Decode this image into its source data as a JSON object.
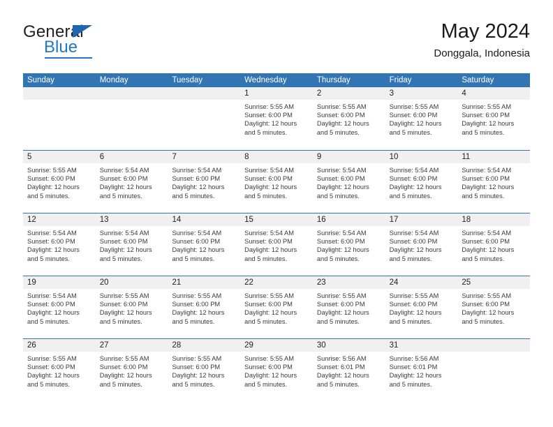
{
  "logo": {
    "word_one": "General",
    "word_two": "Blue",
    "triangle_color": "#1f66ad",
    "blue_color": "#2079c6"
  },
  "header": {
    "title": "May 2024",
    "subtitle": "Donggala, Indonesia"
  },
  "theme": {
    "header_blue": "#3175b5",
    "day_band_gray": "#f0f0f0",
    "text_color": "#3a3a3a"
  },
  "weekdays": [
    "Sunday",
    "Monday",
    "Tuesday",
    "Wednesday",
    "Thursday",
    "Friday",
    "Saturday"
  ],
  "weeks": [
    [
      {
        "day": "",
        "lines": []
      },
      {
        "day": "",
        "lines": []
      },
      {
        "day": "",
        "lines": []
      },
      {
        "day": "1",
        "lines": [
          "Sunrise: 5:55 AM",
          "Sunset: 6:00 PM",
          "Daylight: 12 hours",
          "and 5 minutes."
        ]
      },
      {
        "day": "2",
        "lines": [
          "Sunrise: 5:55 AM",
          "Sunset: 6:00 PM",
          "Daylight: 12 hours",
          "and 5 minutes."
        ]
      },
      {
        "day": "3",
        "lines": [
          "Sunrise: 5:55 AM",
          "Sunset: 6:00 PM",
          "Daylight: 12 hours",
          "and 5 minutes."
        ]
      },
      {
        "day": "4",
        "lines": [
          "Sunrise: 5:55 AM",
          "Sunset: 6:00 PM",
          "Daylight: 12 hours",
          "and 5 minutes."
        ]
      }
    ],
    [
      {
        "day": "5",
        "lines": [
          "Sunrise: 5:55 AM",
          "Sunset: 6:00 PM",
          "Daylight: 12 hours",
          "and 5 minutes."
        ]
      },
      {
        "day": "6",
        "lines": [
          "Sunrise: 5:54 AM",
          "Sunset: 6:00 PM",
          "Daylight: 12 hours",
          "and 5 minutes."
        ]
      },
      {
        "day": "7",
        "lines": [
          "Sunrise: 5:54 AM",
          "Sunset: 6:00 PM",
          "Daylight: 12 hours",
          "and 5 minutes."
        ]
      },
      {
        "day": "8",
        "lines": [
          "Sunrise: 5:54 AM",
          "Sunset: 6:00 PM",
          "Daylight: 12 hours",
          "and 5 minutes."
        ]
      },
      {
        "day": "9",
        "lines": [
          "Sunrise: 5:54 AM",
          "Sunset: 6:00 PM",
          "Daylight: 12 hours",
          "and 5 minutes."
        ]
      },
      {
        "day": "10",
        "lines": [
          "Sunrise: 5:54 AM",
          "Sunset: 6:00 PM",
          "Daylight: 12 hours",
          "and 5 minutes."
        ]
      },
      {
        "day": "11",
        "lines": [
          "Sunrise: 5:54 AM",
          "Sunset: 6:00 PM",
          "Daylight: 12 hours",
          "and 5 minutes."
        ]
      }
    ],
    [
      {
        "day": "12",
        "lines": [
          "Sunrise: 5:54 AM",
          "Sunset: 6:00 PM",
          "Daylight: 12 hours",
          "and 5 minutes."
        ]
      },
      {
        "day": "13",
        "lines": [
          "Sunrise: 5:54 AM",
          "Sunset: 6:00 PM",
          "Daylight: 12 hours",
          "and 5 minutes."
        ]
      },
      {
        "day": "14",
        "lines": [
          "Sunrise: 5:54 AM",
          "Sunset: 6:00 PM",
          "Daylight: 12 hours",
          "and 5 minutes."
        ]
      },
      {
        "day": "15",
        "lines": [
          "Sunrise: 5:54 AM",
          "Sunset: 6:00 PM",
          "Daylight: 12 hours",
          "and 5 minutes."
        ]
      },
      {
        "day": "16",
        "lines": [
          "Sunrise: 5:54 AM",
          "Sunset: 6:00 PM",
          "Daylight: 12 hours",
          "and 5 minutes."
        ]
      },
      {
        "day": "17",
        "lines": [
          "Sunrise: 5:54 AM",
          "Sunset: 6:00 PM",
          "Daylight: 12 hours",
          "and 5 minutes."
        ]
      },
      {
        "day": "18",
        "lines": [
          "Sunrise: 5:54 AM",
          "Sunset: 6:00 PM",
          "Daylight: 12 hours",
          "and 5 minutes."
        ]
      }
    ],
    [
      {
        "day": "19",
        "lines": [
          "Sunrise: 5:54 AM",
          "Sunset: 6:00 PM",
          "Daylight: 12 hours",
          "and 5 minutes."
        ]
      },
      {
        "day": "20",
        "lines": [
          "Sunrise: 5:55 AM",
          "Sunset: 6:00 PM",
          "Daylight: 12 hours",
          "and 5 minutes."
        ]
      },
      {
        "day": "21",
        "lines": [
          "Sunrise: 5:55 AM",
          "Sunset: 6:00 PM",
          "Daylight: 12 hours",
          "and 5 minutes."
        ]
      },
      {
        "day": "22",
        "lines": [
          "Sunrise: 5:55 AM",
          "Sunset: 6:00 PM",
          "Daylight: 12 hours",
          "and 5 minutes."
        ]
      },
      {
        "day": "23",
        "lines": [
          "Sunrise: 5:55 AM",
          "Sunset: 6:00 PM",
          "Daylight: 12 hours",
          "and 5 minutes."
        ]
      },
      {
        "day": "24",
        "lines": [
          "Sunrise: 5:55 AM",
          "Sunset: 6:00 PM",
          "Daylight: 12 hours",
          "and 5 minutes."
        ]
      },
      {
        "day": "25",
        "lines": [
          "Sunrise: 5:55 AM",
          "Sunset: 6:00 PM",
          "Daylight: 12 hours",
          "and 5 minutes."
        ]
      }
    ],
    [
      {
        "day": "26",
        "lines": [
          "Sunrise: 5:55 AM",
          "Sunset: 6:00 PM",
          "Daylight: 12 hours",
          "and 5 minutes."
        ]
      },
      {
        "day": "27",
        "lines": [
          "Sunrise: 5:55 AM",
          "Sunset: 6:00 PM",
          "Daylight: 12 hours",
          "and 5 minutes."
        ]
      },
      {
        "day": "28",
        "lines": [
          "Sunrise: 5:55 AM",
          "Sunset: 6:00 PM",
          "Daylight: 12 hours",
          "and 5 minutes."
        ]
      },
      {
        "day": "29",
        "lines": [
          "Sunrise: 5:55 AM",
          "Sunset: 6:00 PM",
          "Daylight: 12 hours",
          "and 5 minutes."
        ]
      },
      {
        "day": "30",
        "lines": [
          "Sunrise: 5:56 AM",
          "Sunset: 6:01 PM",
          "Daylight: 12 hours",
          "and 5 minutes."
        ]
      },
      {
        "day": "31",
        "lines": [
          "Sunrise: 5:56 AM",
          "Sunset: 6:01 PM",
          "Daylight: 12 hours",
          "and 5 minutes."
        ]
      },
      {
        "day": "",
        "lines": []
      }
    ]
  ]
}
